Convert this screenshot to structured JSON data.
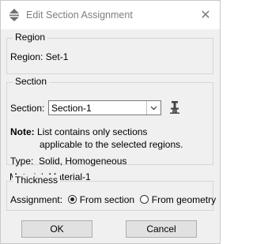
{
  "window": {
    "title": "Edit Section Assignment",
    "close_glyph": "✕"
  },
  "region": {
    "group_label": "Region",
    "label": "Region:",
    "value": "Set-1"
  },
  "section": {
    "group_label": "Section",
    "label": "Section:",
    "selected": "Section-1",
    "note_label": "Note:",
    "note_line1": "List contains only sections",
    "note_line2": "applicable to the selected regions.",
    "type_label": "Type:",
    "type_value": "Solid, Homogeneous",
    "material_label": "Material:",
    "material_value": "Material-1"
  },
  "thickness": {
    "group_label": "Thickness",
    "assignment_label": "Assignment:",
    "option_section": "From section",
    "option_geometry": "From geometry",
    "selected": "From section"
  },
  "buttons": {
    "ok": "OK",
    "cancel": "Cancel"
  }
}
